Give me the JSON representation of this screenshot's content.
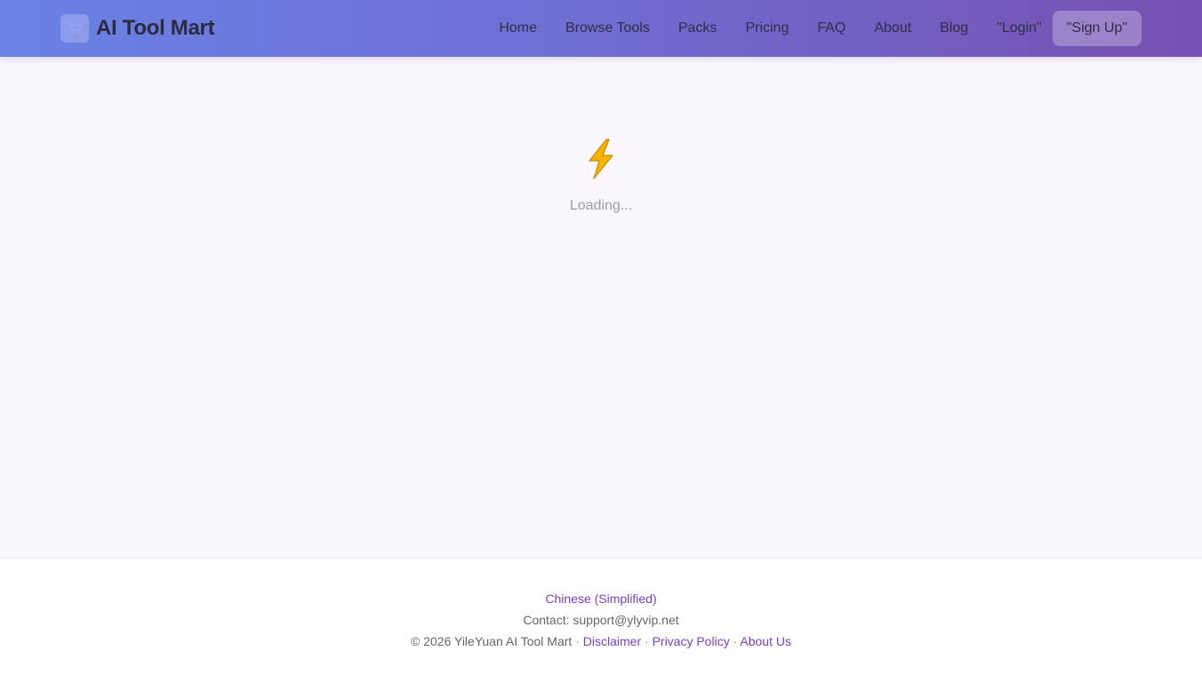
{
  "brand": {
    "icon": "cart-icon",
    "title": "AI Tool Mart"
  },
  "nav": {
    "items": [
      "Home",
      "Browse Tools",
      "Packs",
      "Pricing",
      "FAQ",
      "About",
      "Blog"
    ],
    "login": "\"Login\"",
    "signup": "\"Sign Up\""
  },
  "main": {
    "loader_icon": "lightning-icon",
    "loading_text": "Loading..."
  },
  "footer": {
    "language": "Chinese (Simplified)",
    "contact_prefix": "Contact: ",
    "contact_email": "support@ylyvip.net",
    "copyright": "© 2026 YileYuan AI Tool Mart",
    "separator": " · ",
    "disclaimer": "Disclaimer",
    "privacy": "Privacy Policy",
    "about_us": "About Us"
  },
  "colors": {
    "header_gradient_start": "#6a82e6",
    "header_gradient_end": "#7650b0",
    "page_bg": "#fbf7fe",
    "link": "#7a3fcf",
    "bolt": "#f5b400"
  }
}
